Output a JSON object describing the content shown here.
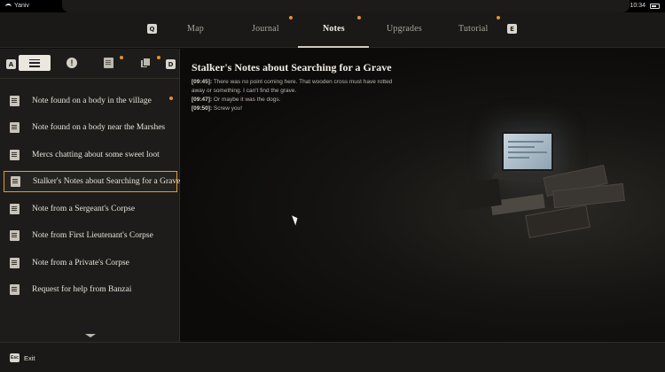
{
  "status_bar": {
    "user": "Yaniv",
    "time": "10:34"
  },
  "top_nav": {
    "left_key": "Q",
    "right_key": "E",
    "tabs": [
      {
        "label": "Map",
        "active": false,
        "new": false
      },
      {
        "label": "Journal",
        "active": false,
        "new": true
      },
      {
        "label": "Notes",
        "active": true,
        "new": true
      },
      {
        "label": "Upgrades",
        "active": false,
        "new": false
      },
      {
        "label": "Tutorial",
        "active": false,
        "new": true
      }
    ]
  },
  "filters": {
    "left_key": "A",
    "right_key": "D",
    "buttons": [
      {
        "icon": "list-icon",
        "active": true
      },
      {
        "icon": "exclamation-icon",
        "active": false
      },
      {
        "icon": "note-icon",
        "active": false,
        "new": true
      },
      {
        "icon": "notes-stack-icon",
        "active": false,
        "new": true
      }
    ]
  },
  "notes": [
    {
      "label": "Note found on a body in the village",
      "new": true
    },
    {
      "label": "Note found on a body near the Marshes",
      "new": false
    },
    {
      "label": "Mercs chatting about some sweet loot",
      "new": false
    },
    {
      "label": "Stalker's Notes about Searching for a Grave",
      "new": false,
      "selected": true
    },
    {
      "label": "Note from a Sergeant's Corpse",
      "new": false
    },
    {
      "label": "Note from First Lieutenant's Corpse",
      "new": false
    },
    {
      "label": "Note from a Private's Corpse",
      "new": false
    },
    {
      "label": "Request for help from Banzai",
      "new": false
    }
  ],
  "selected_note": {
    "title": "Stalker's Notes about Searching for a Grave",
    "entries": [
      {
        "time": "[09:45]:",
        "text": " There was no point coming here. That wooden cross must have rotted away or something. I can't find the grave."
      },
      {
        "time": "[09:47]:",
        "text": " Or maybe it was the dogs."
      },
      {
        "time": "[09:50]:",
        "text": " Screw you!"
      }
    ]
  },
  "bottom_bar": {
    "exit_key": "Esc",
    "exit_label": "Exit"
  },
  "colors": {
    "accent": "#e29a3a",
    "background": "#0e0d0c",
    "panel": "#1d1c1a"
  }
}
